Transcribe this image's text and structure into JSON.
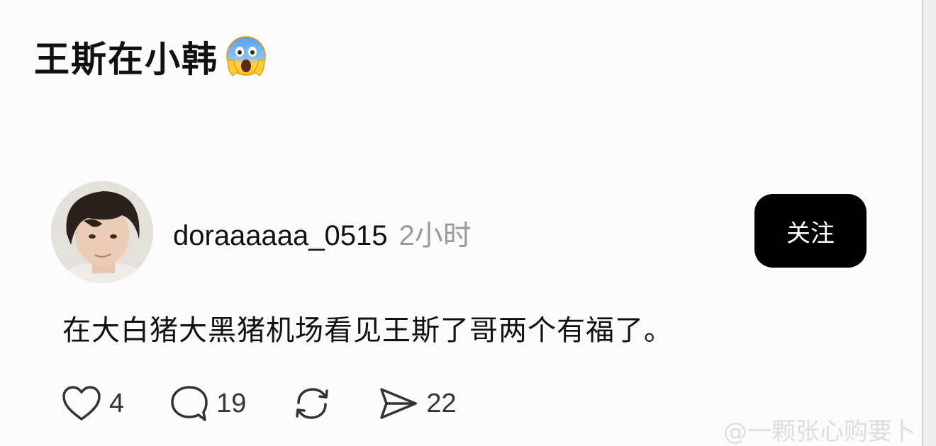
{
  "headline": {
    "text": "王斯在小韩",
    "emoji": "screaming-face-emoji"
  },
  "post": {
    "avatar": "user-avatar-photo",
    "username": "doraaaaaa_0515",
    "time": "2小时",
    "follow_label": "关注",
    "text": "在大白猪大黑猪机场看见王斯了哥两个有福了。",
    "actions": {
      "like": {
        "icon": "heart-icon",
        "count": "4"
      },
      "comment": {
        "icon": "comment-bubble-icon",
        "count": "19"
      },
      "repost": {
        "icon": "repost-icon"
      },
      "share": {
        "icon": "send-icon",
        "count": "22"
      }
    }
  },
  "watermark": "@一颗张心购要卜",
  "colors": {
    "follow_bg": "#000000",
    "follow_text": "#ffffff",
    "muted_text": "#9a9a9a",
    "primary_text": "#111111"
  }
}
